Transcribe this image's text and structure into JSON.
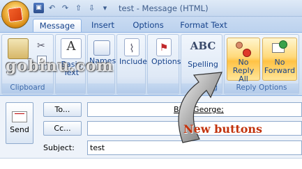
{
  "window": {
    "title": "test - Message (HTML)",
    "qat_icons": [
      "save-icon",
      "undo-icon",
      "redo-icon",
      "up-arrow-icon",
      "down-arrow-icon",
      "customize-icon"
    ]
  },
  "tabs": [
    {
      "label": "Message",
      "active": true
    },
    {
      "label": "Insert",
      "active": false
    },
    {
      "label": "Options",
      "active": false
    },
    {
      "label": "Format Text",
      "active": false
    }
  ],
  "ribbon": {
    "groups": [
      {
        "name": "clipboard",
        "label": "Clipboard",
        "buttons": [
          "Paste"
        ]
      },
      {
        "name": "basic-text",
        "label": "",
        "buttons": [
          "Basic Text"
        ]
      },
      {
        "name": "names",
        "label": "",
        "buttons": [
          "Names"
        ]
      },
      {
        "name": "include",
        "label": "",
        "buttons": [
          "Include"
        ]
      },
      {
        "name": "options",
        "label": "",
        "buttons": [
          "Options"
        ]
      },
      {
        "name": "proofing",
        "label": "ing",
        "buttons": [
          "Spelling"
        ]
      },
      {
        "name": "reply-options",
        "label": "Reply Options",
        "buttons": [
          "No Reply All",
          "No Forward"
        ]
      }
    ],
    "basic_text_line1": "Basic",
    "basic_text_line2": "Text",
    "names_label": "Names",
    "include_label": "Include",
    "options_label": "Options",
    "spelling_label": "Spelling",
    "proofing_label": "ing",
    "clipboard_label": "Clipboard",
    "reply_options_label": "Reply Options",
    "no_reply_all_line1": "No",
    "no_reply_all_line2": "Reply All",
    "no_forward_line1": "No",
    "no_forward_line2": "Forward",
    "abc_text": "ABC"
  },
  "compose": {
    "send_label": "Send",
    "to_label": "To...",
    "cc_label": "Cc...",
    "subject_label": "Subject:",
    "to_value": "Binu George;",
    "cc_value": "",
    "subject_value": "test"
  },
  "watermark": "gobinu.com",
  "annotation": "New buttons",
  "colors": {
    "accent": "#15428b",
    "annotation": "#c2330d",
    "highlight": "#ffc245"
  }
}
